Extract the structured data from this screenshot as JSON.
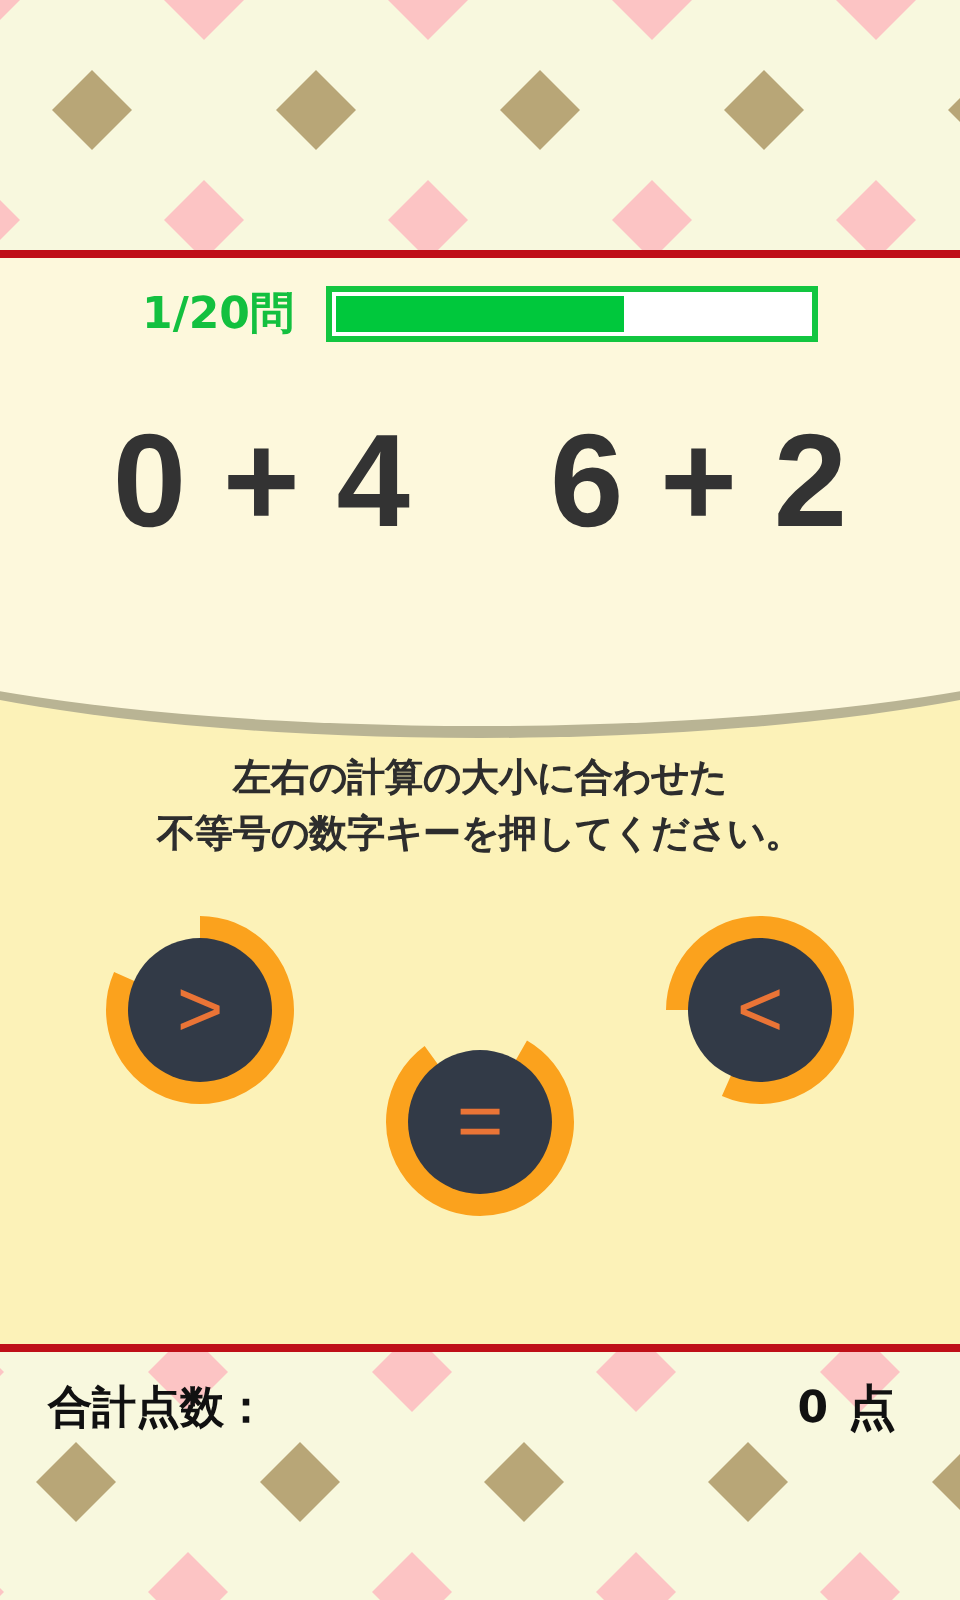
{
  "progress": {
    "label": "1/20問",
    "level": 0.61
  },
  "problem": {
    "left": "0 + 4",
    "right": "6 + 2"
  },
  "instruction": [
    "左右の計算の大小に合わせた",
    "不等号の数字キーを押してください。"
  ],
  "keys": [
    {
      "symbol": ">",
      "kind": "greater"
    },
    {
      "symbol": "=",
      "kind": "equal"
    },
    {
      "symbol": "<",
      "kind": "less"
    }
  ],
  "score": {
    "label": "合計点数：",
    "value": "0",
    "unit": "点"
  }
}
